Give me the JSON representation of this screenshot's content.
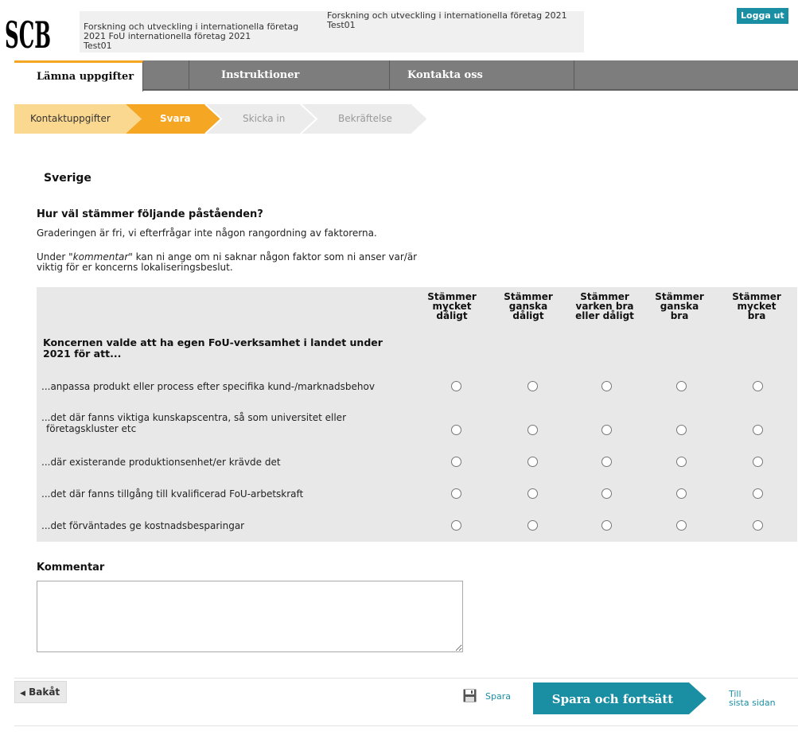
{
  "header": {
    "logo_text": "SCB",
    "left_line1": "Forskning och utveckling i internationella företag",
    "left_line2": "2021 FoU internationella företag 2021",
    "left_line3": "Test01",
    "right_line1": "Forskning och utveckling i internationella företag 2021",
    "right_line2": "Test01",
    "logout_label": "Logga ut"
  },
  "nav": {
    "tabs": [
      {
        "label": "Lämna uppgifter",
        "active": true
      },
      {
        "label": "Instruktioner",
        "active": false
      },
      {
        "label": "Kontakta oss",
        "active": false
      }
    ]
  },
  "steps": [
    {
      "label": "Kontaktuppgifter",
      "state": "done"
    },
    {
      "label": "Svara",
      "state": "current"
    },
    {
      "label": "Skicka in",
      "state": "pending"
    },
    {
      "label": "Bekräftelse",
      "state": "pending"
    }
  ],
  "section_title": "Sverige",
  "question": {
    "title": "Hur väl stämmer följande påståenden?",
    "desc": "Graderingen är fri, vi efterfrågar inte någon rangordning av faktorerna.",
    "note_prefix": "Under \"",
    "note_em": "kommentar",
    "note_suffix": "\" kan ni ange om ni saknar någon faktor som ni anser var/är viktig för er koncerns lokaliseringsbeslut."
  },
  "grid": {
    "columns": [
      {
        "line1": "Stämmer",
        "line2": "mycket",
        "line3": "dåligt"
      },
      {
        "line1": "Stämmer",
        "line2": "ganska",
        "line3": "dåligt"
      },
      {
        "line1": "Stämmer",
        "line2": "varken bra",
        "line3": "eller dåligt"
      },
      {
        "line1": "Stämmer",
        "line2": "ganska",
        "line3": "bra"
      },
      {
        "line1": "Stämmer",
        "line2": "mycket",
        "line3": "bra"
      }
    ],
    "lead": "Koncernen valde att ha egen FoU-verksamhet i landet under 2021 för att...",
    "rows": [
      {
        "label": "...anpassa produkt eller process efter specifika kund-/marknadsbehov"
      },
      {
        "label": "...det där fanns viktiga kunskapscentra, så som universitet eller företagskluster etc"
      },
      {
        "label": "...där existerande produktionsenhet/er krävde det"
      },
      {
        "label": "...det där fanns tillgång till kvalificerad FoU-arbetskraft"
      },
      {
        "label": "...det förväntades ge kostnadsbesparingar"
      }
    ]
  },
  "comment": {
    "label": "Kommentar",
    "value": ""
  },
  "footer": {
    "back_label": "Bakåt",
    "save_label": "Spara",
    "save_continue_label": "Spara och fortsätt",
    "last_page_line1": "Till",
    "last_page_line2": "sista sidan"
  },
  "colors": {
    "accent": "#f5a623",
    "done_step": "#fbd88f",
    "teal": "#1a8fa3",
    "nav_gray": "#7d7d7d"
  }
}
